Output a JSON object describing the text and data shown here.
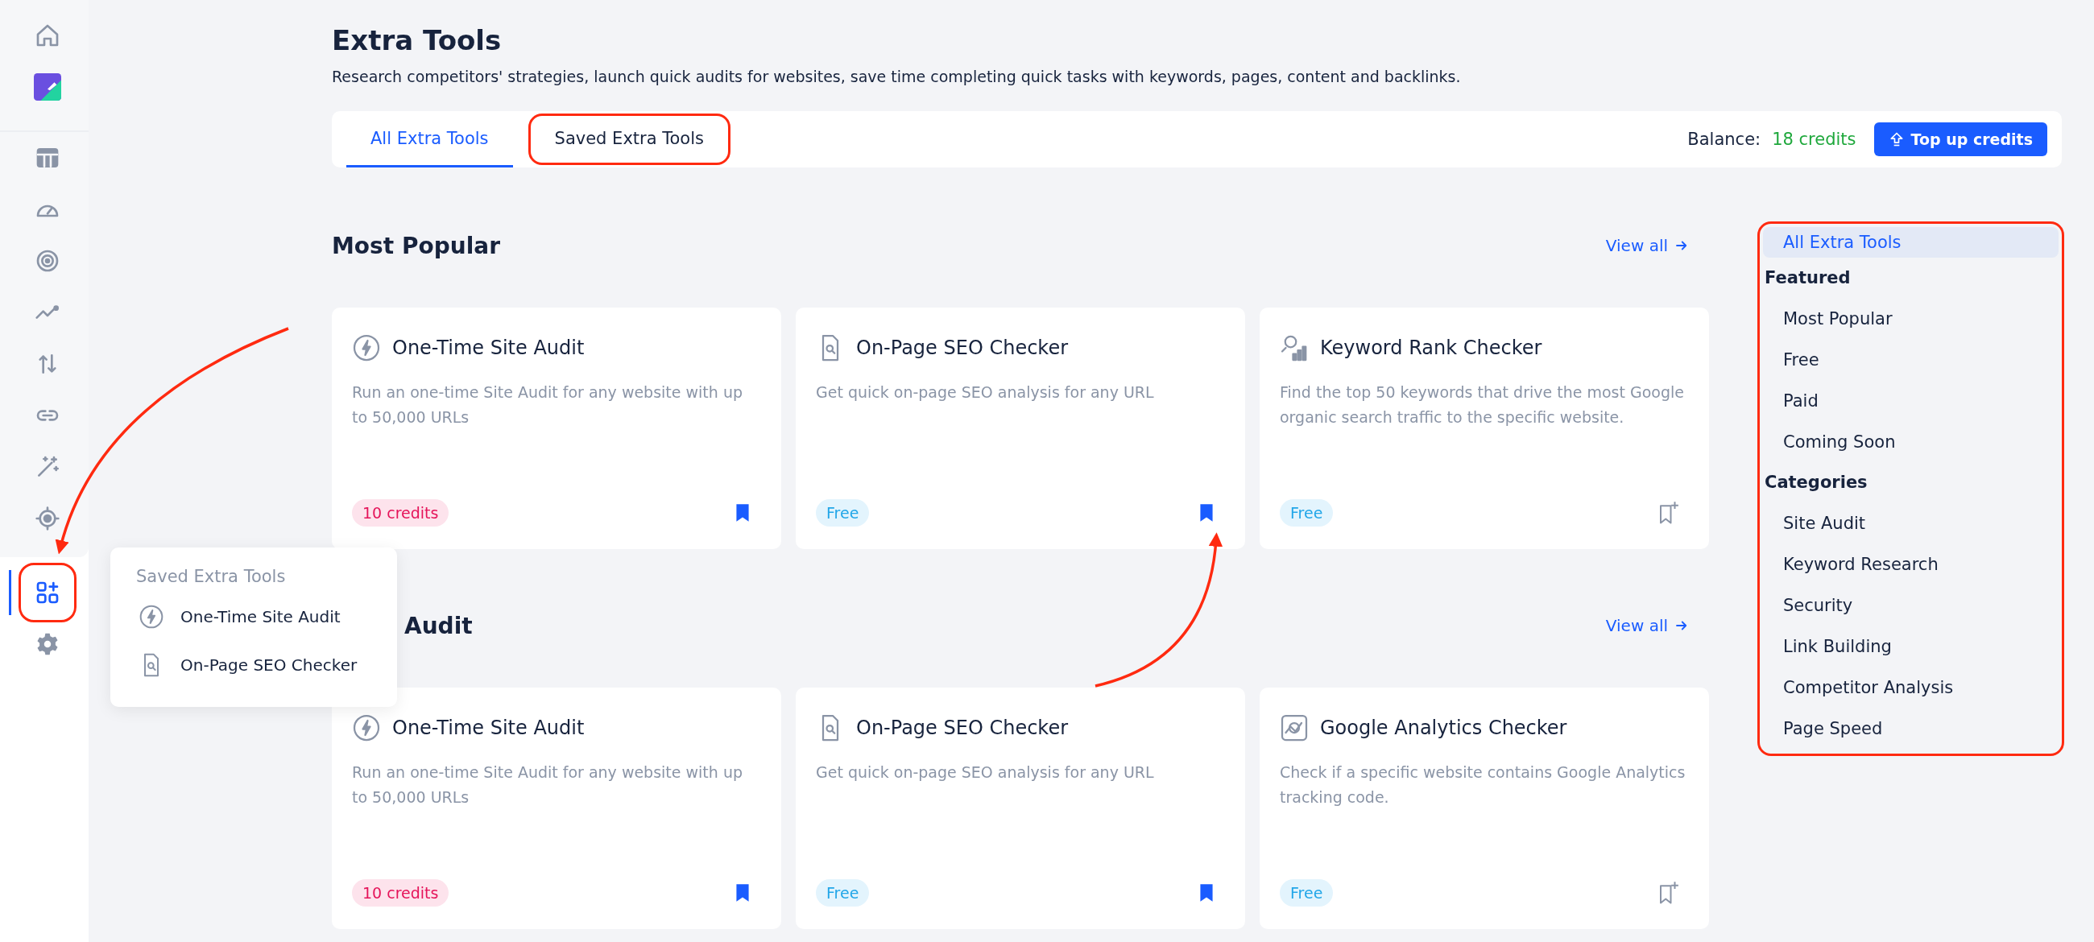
{
  "sidebar": {
    "items": [
      {
        "kind": "home",
        "selected": false,
        "highlighted": false
      },
      {
        "kind": "logo",
        "selected": false,
        "highlighted": false
      },
      {
        "kind": "table",
        "selected": false,
        "highlighted": false
      },
      {
        "kind": "gauge",
        "selected": false,
        "highlighted": false
      },
      {
        "kind": "radar",
        "selected": false,
        "highlighted": false
      },
      {
        "kind": "trend",
        "selected": false,
        "highlighted": false
      },
      {
        "kind": "sort",
        "selected": false,
        "highlighted": false
      },
      {
        "kind": "link",
        "selected": false,
        "highlighted": false
      },
      {
        "kind": "wand",
        "selected": false,
        "highlighted": false
      },
      {
        "kind": "target",
        "selected": false,
        "highlighted": false
      },
      {
        "kind": "apps",
        "selected": true,
        "highlighted": true
      },
      {
        "kind": "gear",
        "selected": false,
        "highlighted": false
      }
    ]
  },
  "popup": {
    "title": "Saved Extra Tools",
    "items": [
      {
        "kind": "bolt",
        "label": "One-Time Site Audit"
      },
      {
        "kind": "doc",
        "label": "On-Page SEO Checker"
      }
    ]
  },
  "header": {
    "title": "Extra Tools",
    "subtitle": "Research competitors' strategies, launch quick audits for websites, save time completing quick tasks with keywords, pages, content and backlinks."
  },
  "tabs": [
    {
      "label": "All Extra Tools",
      "selected": true,
      "highlighted": false
    },
    {
      "label": "Saved Extra Tools",
      "selected": false,
      "highlighted": true
    }
  ],
  "balance": {
    "label": "Balance:",
    "value": "18 credits"
  },
  "top_up_button": "Top up credits",
  "sections": [
    {
      "title": "Most Popular",
      "covered": false,
      "view_all": "View all",
      "cards": [
        {
          "kind": "bolt",
          "title": "One-Time Site Audit",
          "description": "Run an one-time Site Audit for any website with up to 50,000 URLs",
          "price": {
            "kind": "paid",
            "text": "10 credits"
          },
          "saved": true
        },
        {
          "kind": "doc",
          "title": "On-Page SEO Checker",
          "description": "Get quick on-page SEO analysis for any URL",
          "price": {
            "kind": "free",
            "text": "Free"
          },
          "saved": true
        },
        {
          "kind": "rank",
          "title": "Keyword Rank Checker",
          "description": "Find the top 50 keywords that drive the most Google organic search traffic to the specific website.",
          "price": {
            "kind": "free",
            "text": "Free"
          },
          "saved": false
        }
      ]
    },
    {
      "title": "Audit",
      "covered": true,
      "view_all": "View all",
      "cards": [
        {
          "kind": "bolt",
          "title": "One-Time Site Audit",
          "description": "Run an one-time Site Audit for any website with up to 50,000 URLs",
          "price": {
            "kind": "paid",
            "text": "10 credits"
          },
          "saved": true
        },
        {
          "kind": "doc",
          "title": "On-Page SEO Checker",
          "description": "Get quick on-page SEO analysis for any URL",
          "price": {
            "kind": "free",
            "text": "Free"
          },
          "saved": true
        },
        {
          "kind": "analytics",
          "title": "Google Analytics Checker",
          "description": "Check if a specific website contains Google Analytics tracking code.",
          "price": {
            "kind": "free",
            "text": "Free"
          },
          "saved": false
        }
      ]
    }
  ],
  "filter_nav": {
    "highlighted": true,
    "items": [
      {
        "kind": "item",
        "label": "All Extra Tools",
        "selected": true
      },
      {
        "kind": "heading",
        "label": "Featured"
      },
      {
        "kind": "item",
        "label": "Most Popular",
        "selected": false
      },
      {
        "kind": "item",
        "label": "Free",
        "selected": false
      },
      {
        "kind": "item",
        "label": "Paid",
        "selected": false
      },
      {
        "kind": "item",
        "label": "Coming Soon",
        "selected": false
      },
      {
        "kind": "heading",
        "label": "Categories"
      },
      {
        "kind": "item",
        "label": "Site Audit",
        "selected": false
      },
      {
        "kind": "item",
        "label": "Keyword Research",
        "selected": false
      },
      {
        "kind": "item",
        "label": "Security",
        "selected": false
      },
      {
        "kind": "item",
        "label": "Link Building",
        "selected": false
      },
      {
        "kind": "item",
        "label": "Competitor Analysis",
        "selected": false
      },
      {
        "kind": "item",
        "label": "Page Speed",
        "selected": false
      }
    ]
  }
}
